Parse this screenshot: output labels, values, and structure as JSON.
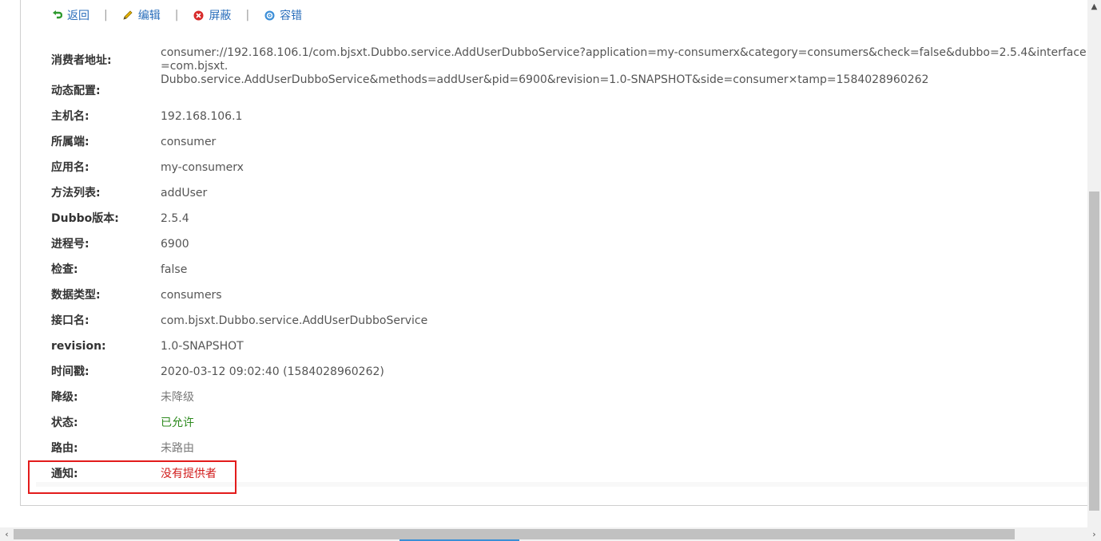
{
  "toolbar": {
    "back_label": "返回",
    "edit_label": "编辑",
    "block_label": "屏蔽",
    "tolerance_label": "容错",
    "separator": "|"
  },
  "details": {
    "address": {
      "label": "消费者地址:",
      "value": "consumer://192.168.106.1/com.bjsxt.Dubbo.service.AddUserDubboService?application=my-consumerx&category=consumers&check=false&dubbo=2.5.4&interface=com.bjsxt.Dubbo.service.AddUserDubboService&methods=addUser&pid=6900&revision=1.0-SNAPSHOT&side=consumer×tamp=1584028960262",
      "line1": "consumer://192.168.106.1/com.bjsxt.Dubbo.service.AddUserDubboService?application=my-consumerx&category=consumers&check=false&dubbo=2.5.4&interface=com.bjsxt.",
      "line2": "Dubbo.service.AddUserDubboService&methods=addUser&pid=6900&revision=1.0-SNAPSHOT&side=consumer×tamp=1584028960262"
    },
    "dynamic_config": {
      "label": "动态配置:",
      "value": ""
    },
    "hostname": {
      "label": "主机名:",
      "value": "192.168.106.1"
    },
    "side": {
      "label": "所属端:",
      "value": "consumer"
    },
    "application": {
      "label": "应用名:",
      "value": "my-consumerx"
    },
    "methods": {
      "label": "方法列表:",
      "value": "addUser"
    },
    "dubbo_version": {
      "label": "Dubbo版本:",
      "value": "2.5.4"
    },
    "pid": {
      "label": "进程号:",
      "value": "6900"
    },
    "check": {
      "label": "检查:",
      "value": "false"
    },
    "category": {
      "label": "数据类型:",
      "value": "consumers"
    },
    "interface": {
      "label": "接口名:",
      "value": "com.bjsxt.Dubbo.service.AddUserDubboService"
    },
    "revision": {
      "label": "revision:",
      "value": "1.0-SNAPSHOT"
    },
    "timestamp": {
      "label": "时间戳:",
      "value": "2020-03-12 09:02:40 (1584028960262)"
    },
    "degrade": {
      "label": "降级:",
      "value": "未降级"
    },
    "status": {
      "label": "状态:",
      "value": "已允许"
    },
    "route": {
      "label": "路由:",
      "value": "未路由"
    },
    "notify": {
      "label": "通知:",
      "value": "没有提供者"
    }
  },
  "colors": {
    "link": "#2a6ebb",
    "status_green": "#2d8a1e",
    "notify_red": "#d11c1c",
    "highlight_border": "#e31b1b"
  },
  "icons": {
    "back": "return-arrow-icon",
    "edit": "pencil-icon",
    "block": "block-x-icon",
    "tolerance": "gear-icon"
  }
}
